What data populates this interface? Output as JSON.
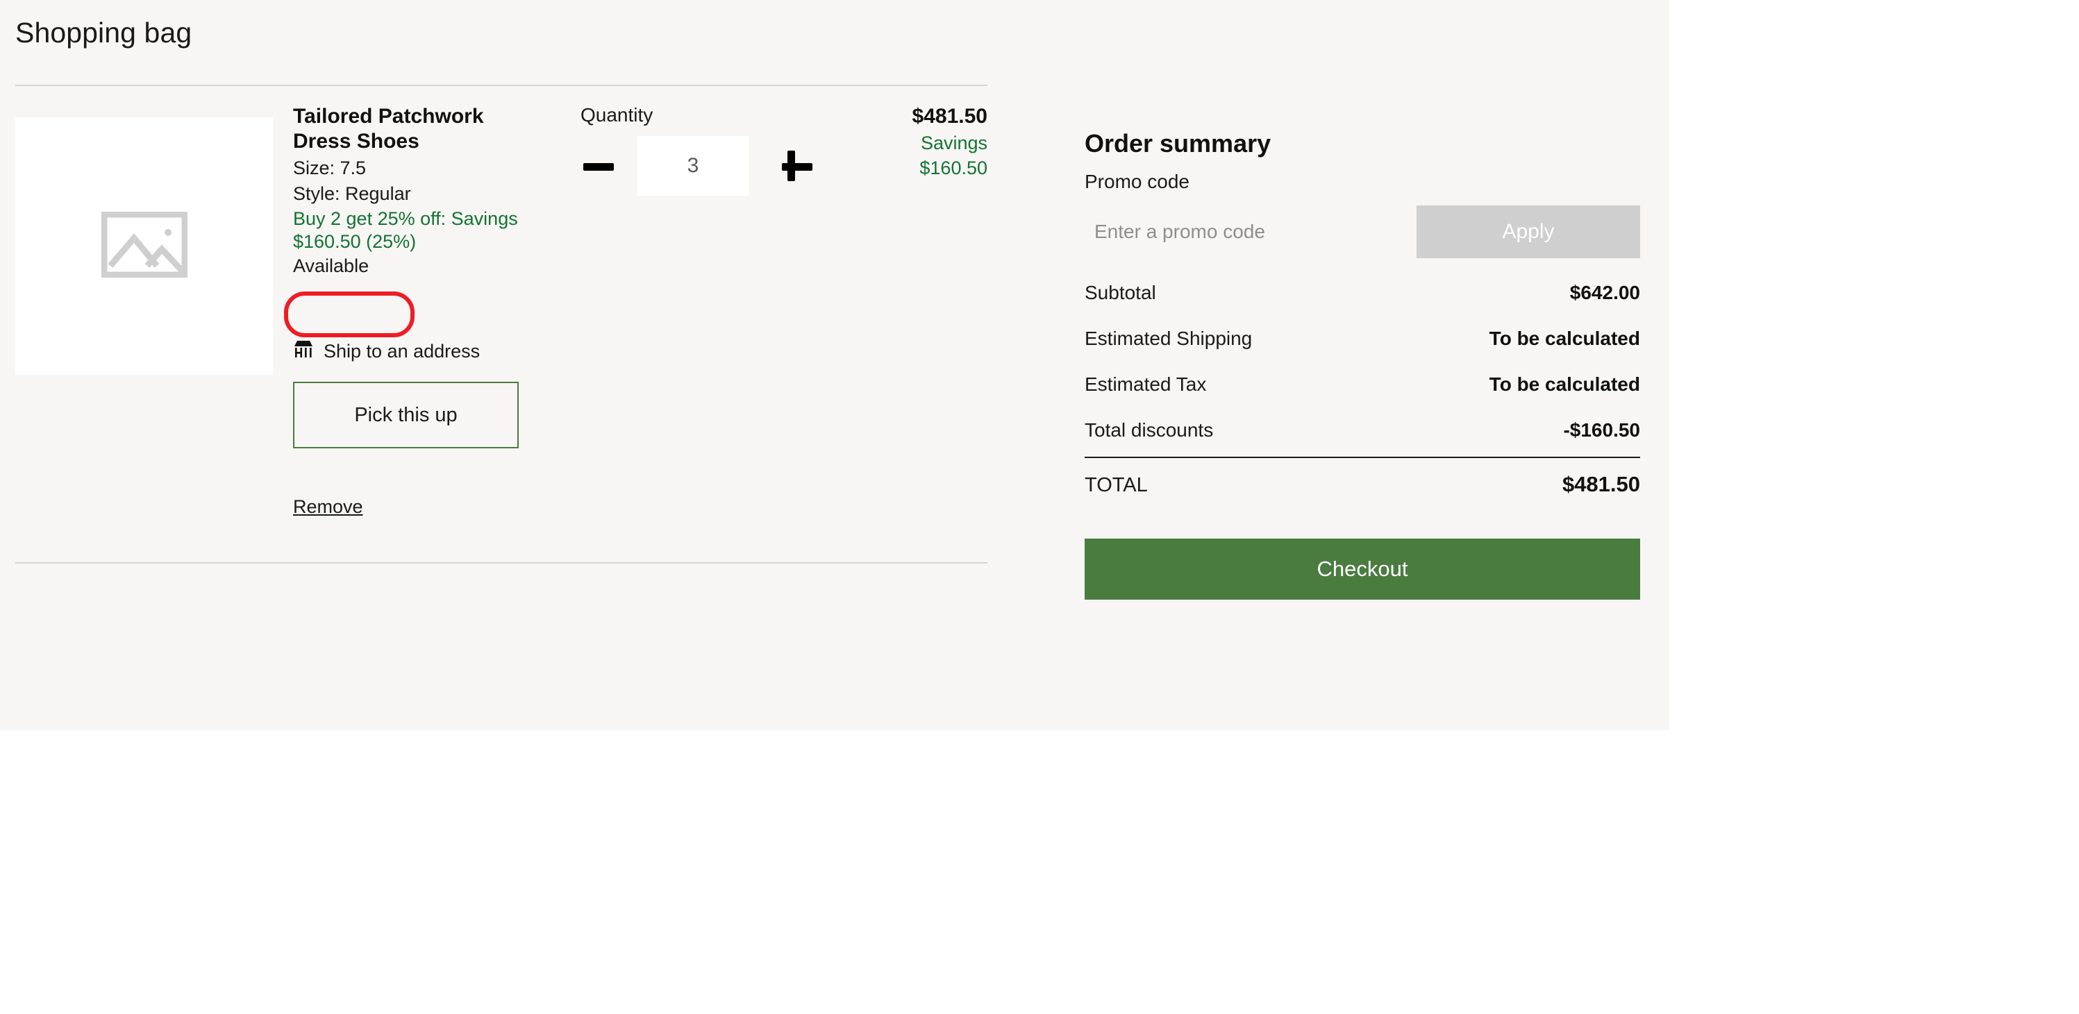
{
  "page": {
    "title": "Shopping bag"
  },
  "cart": {
    "item": {
      "image_icon": "image-placeholder-icon",
      "name": "Tailored Patchwork Dress Shoes",
      "size": "Size: 7.5",
      "style": "Style: Regular",
      "promotion": "Buy 2 get 25% off: Savings $160.50 (25%)",
      "availability": "Available",
      "fulfillment_icon": "storefront-icon",
      "fulfillment_label": "Ship to an address",
      "pickup_label": "Pick this up",
      "remove_label": "Remove",
      "quantity_label": "Quantity",
      "quantity_value": "3",
      "decrement_icon": "minus-icon",
      "increment_icon": "plus-icon",
      "price": "$481.50",
      "savings_label": "Savings",
      "savings_amount": "$160.50"
    }
  },
  "summary": {
    "title": "Order summary",
    "promo_label": "Promo code",
    "promo_placeholder": "Enter a promo code",
    "promo_value": "",
    "apply_label": "Apply",
    "rows": [
      {
        "label": "Subtotal",
        "value": "$642.00"
      },
      {
        "label": "Estimated Shipping",
        "value": "To be calculated"
      },
      {
        "label": "Estimated Tax",
        "value": "To be calculated"
      },
      {
        "label": "Total discounts",
        "value": "-$160.50"
      }
    ],
    "total_label": "TOTAL",
    "total_value": "$481.50",
    "checkout_label": "Checkout"
  },
  "colors": {
    "page_bg": "#f7f6f4",
    "accent_green": "#4a7c3f",
    "savings_green": "#137333",
    "annotation_red": "#ee1c25",
    "apply_disabled": "#cfcfcf"
  }
}
